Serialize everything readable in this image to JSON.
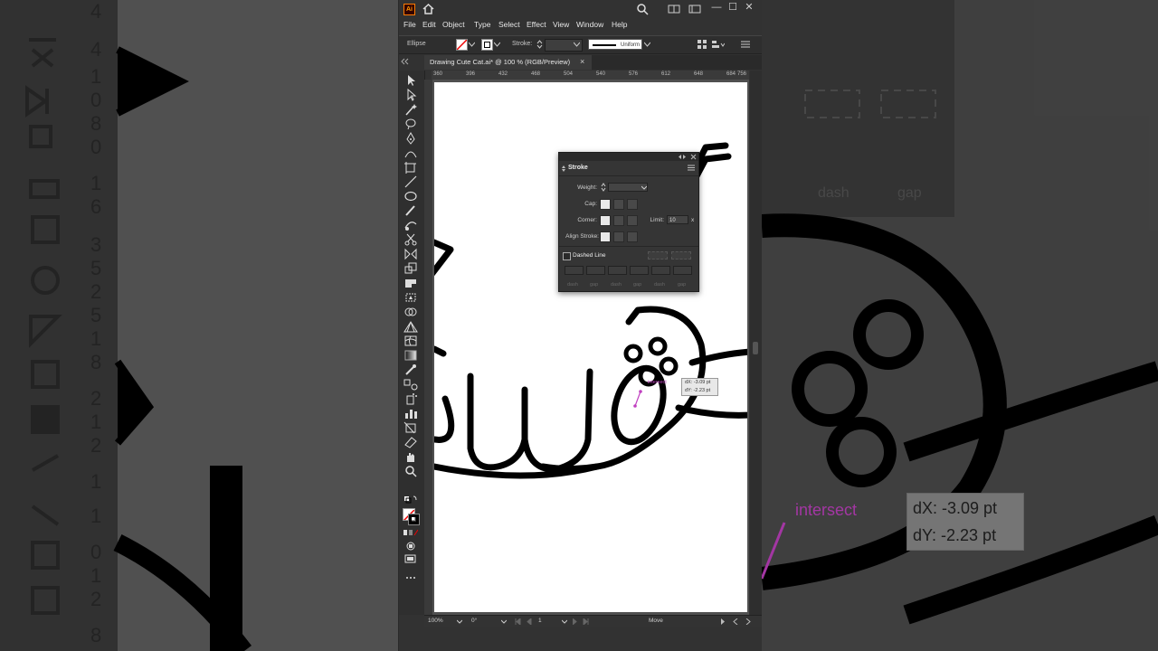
{
  "menu": [
    "File",
    "Edit",
    "Object",
    "Type",
    "Select",
    "Effect",
    "View",
    "Window",
    "Help"
  ],
  "control": {
    "object_type": "Ellipse",
    "stroke_label": "Stroke:",
    "profile": "Uniform"
  },
  "document": {
    "tab_title": "Drawing Cute Cat.ai* @ 100 % (RGB/Preview)",
    "close": "×"
  },
  "ruler_labels": [
    "360",
    "396",
    "432",
    "468",
    "504",
    "540",
    "576",
    "612",
    "648",
    "684",
    "720",
    "756"
  ],
  "stroke_panel": {
    "title": "Stroke",
    "weight_label": "Weight:",
    "cap_label": "Cap:",
    "corner_label": "Corner:",
    "limit_label": "Limit:",
    "limit_value": "10",
    "limit_unit": "x",
    "align_label": "Align Stroke:",
    "dashed_label": "Dashed Line",
    "dash_labels": [
      "dash",
      "gap",
      "dash",
      "gap",
      "dash",
      "gap"
    ]
  },
  "smart_guide": {
    "label": "intersect",
    "dx": "dX: -3.09 pt",
    "dy": "dY: -2.23 pt"
  },
  "status": {
    "zoom": "100%",
    "rotation": "0°",
    "artboard": "1",
    "tool": "Move"
  },
  "window_controls": {
    "minimize": "—",
    "maximize": "☐",
    "close": "✕"
  },
  "background_right": {
    "labels": [
      "dash",
      "gap"
    ],
    "smart_label": "intersect",
    "dx": "dX: -3.09 pt",
    "dy": "dY: -2.23 pt"
  },
  "colors": {
    "accent": "#ff9a00",
    "smart_guide": "#c040c0",
    "canvas": "#ffffff",
    "ui": "#323232"
  }
}
